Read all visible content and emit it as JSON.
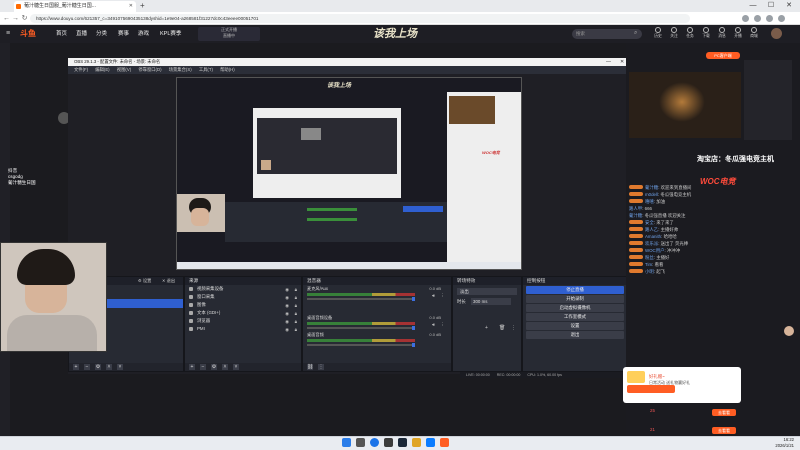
{
  "browser": {
    "tab_title": "葡汁糖生日国服_葡汁糖生日国...",
    "url": "https://www.douyu.com/621357_c=3491075690435138dyshid=1e9e04-a268581f31227dc0c43eeee00051701",
    "new_tab": "+",
    "window": {
      "minimize": "—",
      "maximize": "☐",
      "close": "✕"
    }
  },
  "douyu": {
    "logo": "斗鱼",
    "nav": [
      "首页",
      "直播",
      "分类",
      "赛事",
      "游戏",
      "KPL赛季"
    ],
    "promo_line1": "正式开播",
    "promo_line2": "直播中",
    "banner": "该我上场",
    "search_placeholder": "搜索",
    "user_icons": [
      "历史",
      "关注",
      "任务",
      "下载",
      "消息",
      "开播",
      "商城"
    ]
  },
  "obs": {
    "title": "OBS 29.1.3 - 配置文件: 未命名 - 场景: 未命名",
    "menu": [
      "文件(F)",
      "编辑(E)",
      "视图(V)",
      "停靠窗口(D)",
      "场景集合(S)",
      "工具(T)",
      "帮助(H)"
    ],
    "scenes_header": "场景",
    "sources_header": "来源",
    "sources": [
      {
        "name": "视频采集设备"
      },
      {
        "name": "窗口采集"
      },
      {
        "name": "图像"
      },
      {
        "name": "文本 (GDI+)"
      },
      {
        "name": "浏览器"
      },
      {
        "name": "PMI"
      }
    ],
    "mixer_header": "混音器",
    "mixer": [
      {
        "name": "麦克风/Aux",
        "db": "0.0 dB"
      },
      {
        "name": "桌面音频设备",
        "db": "0.0 dB"
      },
      {
        "name": "桌面音频",
        "db": "0.0 dB"
      }
    ],
    "transitions_header": "转场特效",
    "transition_selected": "淡出",
    "duration_label": "时长",
    "duration_value": "300 ms",
    "controls_header": "控制按钮",
    "controls": [
      "停止直播",
      "开始录制",
      "启动虚拟摄像机",
      "工作室模式",
      "设置",
      "退出"
    ],
    "status": {
      "live": "LIVE: 00:00:00",
      "rec": "REC: 00:00:00",
      "cpu": "CPU: 1.0%, 60.00 fps"
    },
    "scene_buttons": [
      "⚙ 设置",
      "✕ 退出"
    ]
  },
  "overlay": {
    "tiktok_line1": "抖音",
    "tiktok_line2": "csgodg",
    "tiktok_line3": "葡汁糖生日国"
  },
  "chat": {
    "taobao": "淘宝店：冬瓜强电竞主机",
    "woc": "WOC电竞",
    "messages": [
      {
        "user": "葡汁糖",
        "text": "欢迎来到直播间"
      },
      {
        "user": "m0dell",
        "text": "冬瓜强电竞主机"
      },
      {
        "user": "嘻嘻",
        "text": "加油"
      },
      {
        "user": "路人甲",
        "text": "666"
      },
      {
        "user": "葡汁糖",
        "text": "冬瓜强直播 欢迎关注"
      },
      {
        "user": "安全",
        "text": "来了来了"
      },
      {
        "user": "路人乙",
        "text": "主播好帅"
      },
      {
        "user": "Amanith",
        "text": "哈哈哈"
      },
      {
        "user": "欢乐派",
        "text": "送出了 荧光棒"
      },
      {
        "user": "WOC用户",
        "text": "冲冲冲"
      },
      {
        "user": "粉丝",
        "text": "主播好"
      },
      {
        "user": "Tim",
        "text": "看看"
      },
      {
        "user": "小明",
        "text": "起飞"
      }
    ],
    "gift_title": "好礼赠~",
    "gift_text": "日常活动 送礼物赢好礼",
    "red_btn": "去看看",
    "like_count": "25",
    "like_count2": "21"
  },
  "taskbar": {
    "time": "16:22",
    "date": "2026/1/21"
  }
}
